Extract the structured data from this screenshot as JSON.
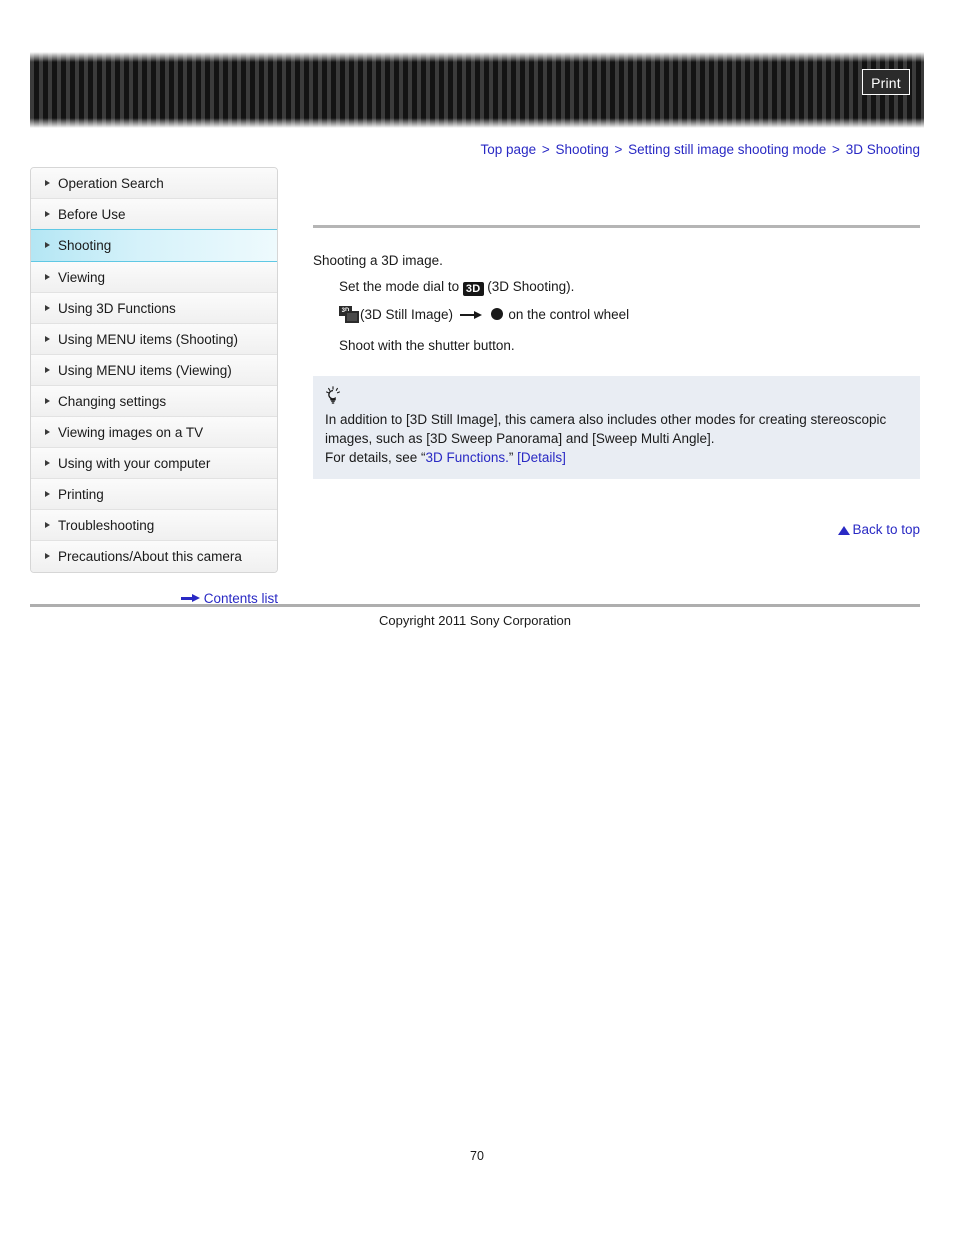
{
  "header": {
    "print_label": "Print"
  },
  "breadcrumb": {
    "separator": ">",
    "items": [
      {
        "label": "Top page"
      },
      {
        "label": "Shooting"
      },
      {
        "label": "Setting still image shooting mode"
      },
      {
        "label": "3D Shooting"
      }
    ]
  },
  "sidebar": {
    "items": [
      {
        "label": "Operation Search",
        "active": false
      },
      {
        "label": "Before Use",
        "active": false
      },
      {
        "label": "Shooting",
        "active": true
      },
      {
        "label": "Viewing",
        "active": false
      },
      {
        "label": "Using 3D Functions",
        "active": false
      },
      {
        "label": "Using MENU items (Shooting)",
        "active": false
      },
      {
        "label": "Using MENU items (Viewing)",
        "active": false
      },
      {
        "label": "Changing settings",
        "active": false
      },
      {
        "label": "Viewing images on a TV",
        "active": false
      },
      {
        "label": "Using with your computer",
        "active": false
      },
      {
        "label": "Printing",
        "active": false
      },
      {
        "label": "Troubleshooting",
        "active": false
      },
      {
        "label": "Precautions/About this camera",
        "active": false
      }
    ],
    "contents_list_label": "Contents list"
  },
  "main": {
    "intro": "Shooting a 3D image.",
    "step1": {
      "before_icon": "Set the mode dial to",
      "icon_label": "3D",
      "after_icon": "(3D Shooting)."
    },
    "step2": {
      "icon_label": "3D",
      "mode_name": "(3D Still Image)",
      "after_arrow": "on the control wheel"
    },
    "step3": {
      "text": "Shoot with the shutter button."
    },
    "tip": {
      "line1": "In addition to [3D Still Image], this camera also includes other modes for creating stereoscopic",
      "line2": "images, such as [3D Sweep Panorama] and [Sweep Multi Angle].",
      "line3_prefix": "For details, see ",
      "line3_quote_open": "“",
      "line3_link": "3D Functions.",
      "line3_quote_close": "”",
      "line3_details": "[Details]"
    },
    "back_to_top_label": "Back to top"
  },
  "footer": {
    "copyright": "Copyright 2011 Sony Corporation",
    "page_number": "70"
  },
  "colors": {
    "link": "#2929c4",
    "active_nav": "#b4e6f4",
    "tip_bg": "#e9edf3"
  }
}
